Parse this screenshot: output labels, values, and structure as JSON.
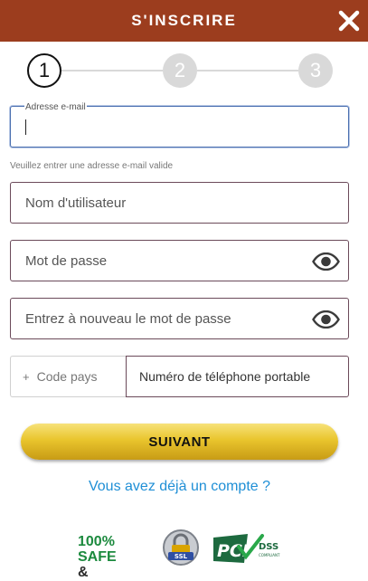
{
  "header": {
    "title": "S'INSCRIRE",
    "close_icon": "close-icon",
    "bg_color": "#9c3d1e"
  },
  "stepper": {
    "steps": [
      {
        "label": "1",
        "state": "active"
      },
      {
        "label": "2",
        "state": "inactive"
      },
      {
        "label": "3",
        "state": "inactive"
      }
    ],
    "current_step": 1
  },
  "form": {
    "email": {
      "label": "Adresse e-mail",
      "value": "",
      "hint": "Veuillez entrer une adresse e-mail valide"
    },
    "username": {
      "placeholder": "Nom d'utilisateur",
      "value": ""
    },
    "password": {
      "placeholder": "Mot de passe",
      "value": "",
      "toggle_icon": "eye-icon"
    },
    "password_confirm": {
      "placeholder": "Entrez à nouveau le mot de passe",
      "value": "",
      "toggle_icon": "eye-icon"
    },
    "country_code": {
      "prefix": "+",
      "placeholder": "Code pays"
    },
    "phone": {
      "placeholder": "Numéro de téléphone portable",
      "value": ""
    }
  },
  "actions": {
    "next_label": "SUIVANT",
    "login_link": "Vous avez déjà un compte ?",
    "link_color": "#1f8fd6"
  },
  "badges": {
    "safe_line1": "100% SAFE",
    "safe_line2": "& SECURE",
    "ssl_text": "SSL",
    "pci_text": "PCI",
    "dss_text": "DSS",
    "compliant_text": "COMPLIANT"
  }
}
